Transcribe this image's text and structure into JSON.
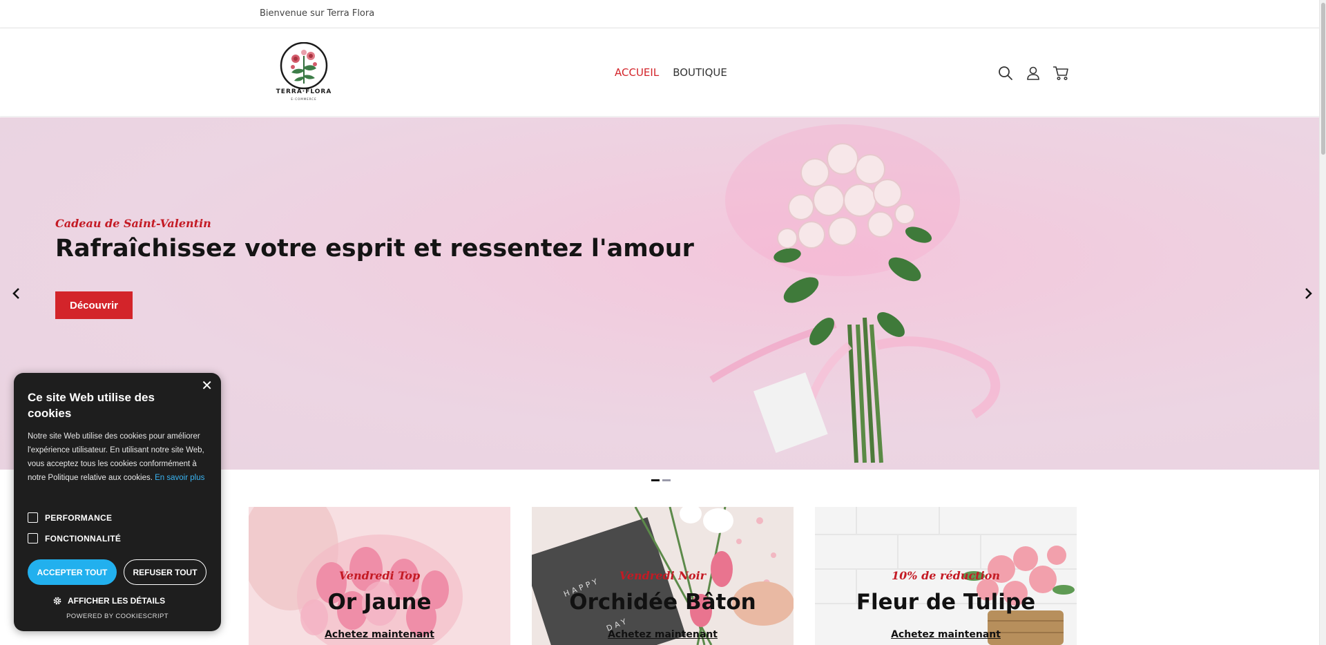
{
  "topbar": {
    "welcome": "Bienvenue sur Terra Flora"
  },
  "brand": {
    "name": "TERRA·FLORA",
    "tagline": "E-COMMERCE"
  },
  "nav": {
    "items": [
      {
        "label": "ACCUEIL",
        "active": true
      },
      {
        "label": "BOUTIQUE",
        "active": false
      }
    ]
  },
  "header_icons": [
    "search-icon",
    "user-icon",
    "cart-icon"
  ],
  "hero": {
    "eyebrow": "Cadeau de Saint-Valentin",
    "title": "Rafraîchissez votre esprit et ressentez l'amour",
    "cta": "Découvrir",
    "slides": 2,
    "active_slide": 1
  },
  "cards": [
    {
      "label": "Vendredi Top",
      "name": "Or Jaune",
      "link": "Achetez maintenant"
    },
    {
      "label": "Vendredi Noir",
      "name": "Orchidée Bâton",
      "link": "Achetez maintenant"
    },
    {
      "label": "10% de réduction",
      "name": "Fleur de Tulipe",
      "link": "Achetez maintenant"
    }
  ],
  "cookie": {
    "title": "Ce site Web utilise des cookies",
    "body": "Notre site Web utilise des cookies pour améliorer l'expérience utilisateur. En utilisant notre site Web, vous acceptez tous les cookies conformément à notre Politique relative aux cookies.",
    "more": "En savoir plus",
    "options": [
      {
        "label": "PERFORMANCE",
        "checked": false
      },
      {
        "label": "FONCTIONNALITÉ",
        "checked": false
      }
    ],
    "accept": "ACCEPTER TOUT",
    "refuse": "REFUSER TOUT",
    "details": "AFFICHER LES DÉTAILS",
    "powered": "POWERED BY COOKIESCRIPT"
  },
  "colors": {
    "accent": "#d3242a",
    "cookie_bg": "#1e1e1e",
    "cookie_accept": "#22b0ee"
  }
}
